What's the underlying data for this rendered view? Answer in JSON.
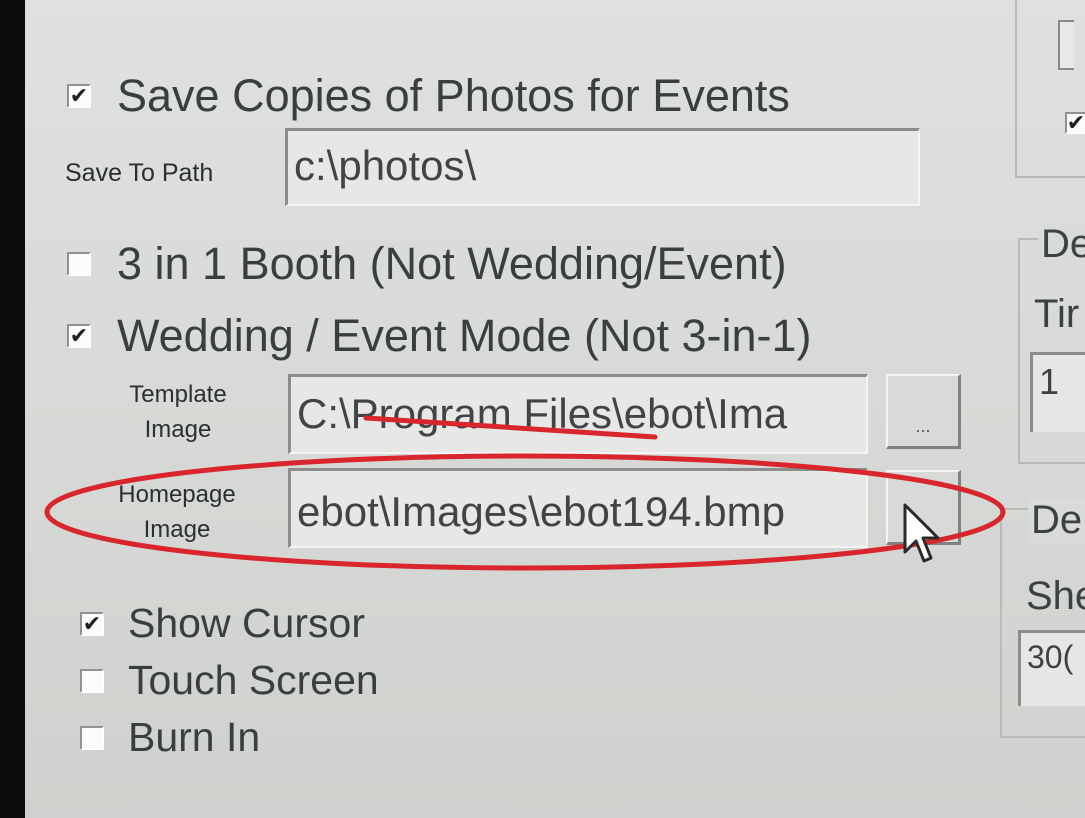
{
  "save_copies": {
    "label": "Save Copies of Photos for Events",
    "checked": "✔"
  },
  "save_to_path": {
    "label": "Save To Path",
    "value": "c:\\photos\\"
  },
  "booth_3in1": {
    "label": "3 in 1 Booth (Not Wedding/Event)",
    "checked": ""
  },
  "wedding_mode": {
    "label": "Wedding / Event Mode  (Not 3-in-1)",
    "checked": "✔"
  },
  "template_image": {
    "label_line1": "Template",
    "label_line2": "Image",
    "value": "C:\\Program Files\\ebot\\Ima",
    "browse": "..."
  },
  "homepage_image": {
    "label_line1": "Homepage",
    "label_line2": "Image",
    "value": "ebot\\Images\\ebot194.bmp",
    "browse": "..."
  },
  "show_cursor": {
    "label": "Show Cursor",
    "checked": "✔"
  },
  "touch_screen": {
    "label": "Touch Screen",
    "checked": ""
  },
  "burn_in": {
    "label": "Burn In",
    "checked": ""
  },
  "right_panel": {
    "group1_title": "De",
    "group1_label": "Tir",
    "group1_value": "1",
    "group2_title": "De",
    "group2_label": "She",
    "group2_value": "30("
  },
  "colors": {
    "annotation_red": "#d8262c"
  }
}
